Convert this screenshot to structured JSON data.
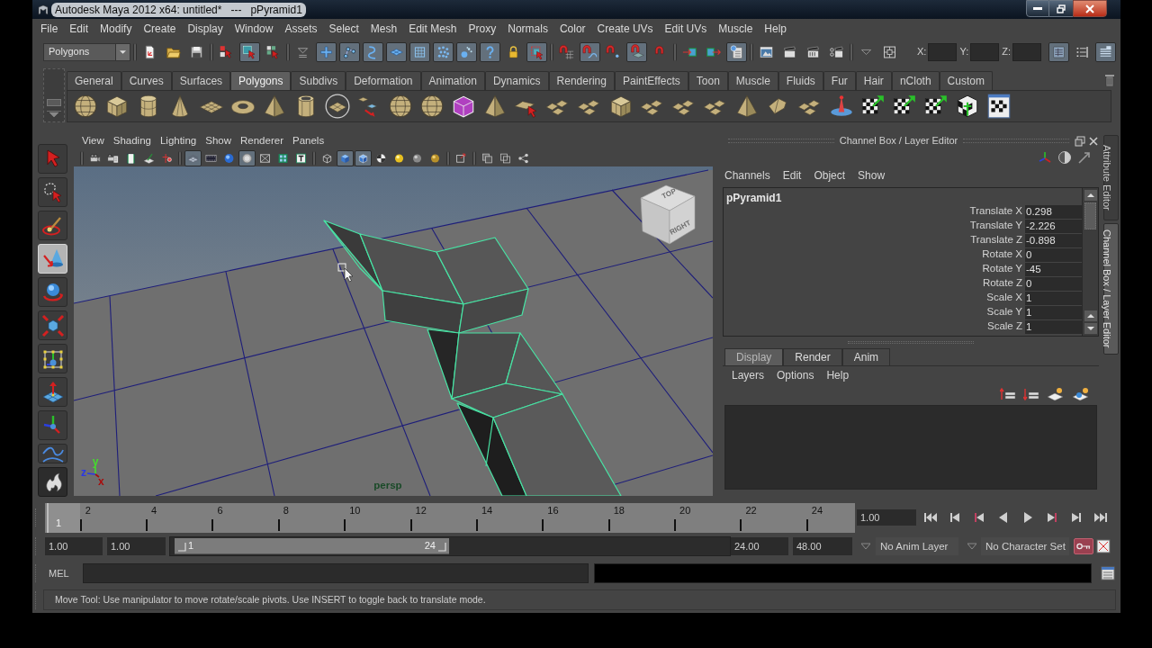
{
  "window": {
    "title": "Autodesk Maya 2012 x64: untitled*   ---   pPyramid1"
  },
  "menu_bar": [
    "File",
    "Edit",
    "Modify",
    "Create",
    "Display",
    "Window",
    "Assets",
    "Select",
    "Mesh",
    "Edit Mesh",
    "Proxy",
    "Normals",
    "Color",
    "Create UVs",
    "Edit UVs",
    "Muscle",
    "Help"
  ],
  "status_line": {
    "menu_set": "Polygons",
    "toggle_groups": [
      [
        {
          "kind": "new-scene",
          "on": false
        },
        {
          "kind": "open-scene",
          "on": false
        },
        {
          "kind": "save-scene",
          "on": false
        }
      ],
      [
        {
          "kind": "select-hierarchy",
          "on": false
        },
        {
          "kind": "select-object",
          "on": true
        },
        {
          "kind": "select-component",
          "on": false
        }
      ],
      [
        {
          "kind": "mask-menu",
          "on": false
        },
        {
          "kind": "mask-handles",
          "on": true
        },
        {
          "kind": "mask-joints",
          "on": true
        },
        {
          "kind": "mask-curves",
          "on": true
        },
        {
          "kind": "mask-surfaces",
          "on": true
        },
        {
          "kind": "mask-deformers",
          "on": true
        },
        {
          "kind": "mask-dynamics",
          "on": true
        },
        {
          "kind": "mask-rendering",
          "on": true
        },
        {
          "kind": "mask-misc",
          "on": true
        },
        {
          "kind": "lock",
          "on": false
        },
        {
          "kind": "highlight",
          "on": true
        }
      ],
      [
        {
          "kind": "snap-grid",
          "on": false
        },
        {
          "kind": "snap-curve",
          "on": true
        },
        {
          "kind": "snap-point",
          "on": false
        },
        {
          "kind": "snap-plane",
          "on": true
        },
        {
          "kind": "make-live",
          "on": false
        }
      ],
      [
        {
          "kind": "inputs",
          "on": false
        },
        {
          "kind": "outputs",
          "on": false
        },
        {
          "kind": "history",
          "on": true
        }
      ],
      [
        {
          "kind": "render-view",
          "on": false
        },
        {
          "kind": "render",
          "on": false
        },
        {
          "kind": "ipr",
          "on": false
        },
        {
          "kind": "render-settings",
          "on": false
        }
      ],
      [
        {
          "kind": "input-menu",
          "on": false
        },
        {
          "kind": "transform-mode",
          "on": false
        }
      ]
    ],
    "fields": [
      {
        "label": "X:"
      },
      {
        "label": "Y:"
      },
      {
        "label": "Z:"
      }
    ],
    "panel_toggles": [
      {
        "kind": "attribute-editor",
        "on": true
      },
      {
        "kind": "tool-settings",
        "on": false
      },
      {
        "kind": "channel-box",
        "on": true
      }
    ]
  },
  "shelf": {
    "tabs": [
      {
        "label": "General",
        "selected": false
      },
      {
        "label": "Curves",
        "selected": false
      },
      {
        "label": "Surfaces",
        "selected": false
      },
      {
        "label": "Polygons",
        "selected": true
      },
      {
        "label": "Subdivs",
        "selected": false
      },
      {
        "label": "Deformation",
        "selected": false
      },
      {
        "label": "Animation",
        "selected": false
      },
      {
        "label": "Dynamics",
        "selected": false
      },
      {
        "label": "Rendering",
        "selected": false
      },
      {
        "label": "PaintEffects",
        "selected": false
      },
      {
        "label": "Toon",
        "selected": false
      },
      {
        "label": "Muscle",
        "selected": false
      },
      {
        "label": "Fluids",
        "selected": false
      },
      {
        "label": "Fur",
        "selected": false
      },
      {
        "label": "Hair",
        "selected": false
      },
      {
        "label": "nCloth",
        "selected": false
      },
      {
        "label": "Custom",
        "selected": false
      }
    ]
  },
  "toolbox": [
    {
      "kind": "select",
      "selected": false
    },
    {
      "kind": "lasso",
      "selected": false
    },
    {
      "kind": "paint",
      "selected": false
    },
    {
      "kind": "move",
      "selected": true
    },
    {
      "kind": "rotate",
      "selected": false
    },
    {
      "kind": "scale",
      "selected": false
    },
    {
      "kind": "universal",
      "selected": false
    },
    {
      "kind": "soft-mod",
      "selected": false
    },
    {
      "kind": "show-manip",
      "selected": false
    },
    {
      "kind": "curve",
      "selected": false
    },
    {
      "kind": "last-tool",
      "selected": false
    }
  ],
  "viewport": {
    "menu": [
      "View",
      "Shading",
      "Lighting",
      "Show",
      "Renderer",
      "Panels"
    ],
    "toolbar_groups": [
      [
        {
          "kind": "camera",
          "on": false
        },
        {
          "kind": "camera-attributes",
          "on": false
        },
        {
          "kind": "bookmarks",
          "on": false
        },
        {
          "kind": "image-plane",
          "on": false
        },
        {
          "kind": "pan-zoom",
          "on": false
        }
      ],
      [
        {
          "kind": "grid",
          "on": true
        },
        {
          "kind": "film-gate",
          "on": false
        },
        {
          "kind": "resolution-gate",
          "on": false
        },
        {
          "kind": "gate-mask",
          "on": true
        },
        {
          "kind": "field-chart",
          "on": false
        },
        {
          "kind": "safe-action",
          "on": false
        },
        {
          "kind": "safe-title",
          "on": false
        }
      ],
      [
        {
          "kind": "wireframe",
          "on": false
        },
        {
          "kind": "smooth-shade",
          "on": true
        },
        {
          "kind": "wire-on-shaded",
          "on": true
        },
        {
          "kind": "textured",
          "on": false
        },
        {
          "kind": "lights",
          "on": false
        },
        {
          "kind": "shadows",
          "on": false
        },
        {
          "kind": "hardware",
          "on": false
        }
      ],
      [
        {
          "kind": "isolate",
          "on": false
        }
      ],
      [
        {
          "kind": "xray",
          "on": false
        },
        {
          "kind": "xray-joints",
          "on": false
        },
        {
          "kind": "share",
          "on": false
        }
      ]
    ],
    "view_cube": {
      "top": "TOP",
      "right": "RIGHT"
    },
    "axis_indicator": [
      {
        "label": "y",
        "color": "#44dd2c"
      },
      {
        "label": "z",
        "color": "#2a38e6"
      },
      {
        "label": "x",
        "color": "#a80c0c"
      }
    ],
    "camera": "persp"
  },
  "channel_box": {
    "title": "Channel Box / Layer Editor",
    "menu": [
      "Channels",
      "Edit",
      "Object",
      "Show"
    ],
    "object": "pPyramid1",
    "channels": [
      {
        "name": "Translate X",
        "value": "0.298"
      },
      {
        "name": "Translate Y",
        "value": "-2.226"
      },
      {
        "name": "Translate Z",
        "value": "-0.898"
      },
      {
        "name": "Rotate X",
        "value": "0"
      },
      {
        "name": "Rotate Y",
        "value": "-45"
      },
      {
        "name": "Rotate Z",
        "value": "0"
      },
      {
        "name": "Scale X",
        "value": "1"
      },
      {
        "name": "Scale Y",
        "value": "1"
      },
      {
        "name": "Scale Z",
        "value": "1"
      }
    ]
  },
  "layer_editor": {
    "tabs": [
      {
        "label": "Display",
        "selected": true
      },
      {
        "label": "Render",
        "selected": false
      },
      {
        "label": "Anim",
        "selected": false
      }
    ],
    "menu": [
      "Layers",
      "Options",
      "Help"
    ]
  },
  "side_tabs": [
    {
      "label": "Attribute Editor",
      "selected": false
    },
    {
      "label": "Channel Box / Layer Editor",
      "selected": true
    }
  ],
  "time_slider": {
    "ticks": [
      "2",
      "4",
      "6",
      "8",
      "10",
      "12",
      "14",
      "16",
      "18",
      "20",
      "22",
      "24"
    ],
    "current_frame": "1",
    "level": 0,
    "current_time": "1.00"
  },
  "range_slider": {
    "animation_start": "1.00",
    "playback_start": "1.00",
    "range_start": "1",
    "range_end": "24",
    "playback_end": "24.00",
    "animation_end": "48.00",
    "anim_layer": "No Anim Layer",
    "character_set": "No Character Set"
  },
  "command_line": {
    "language": "MEL"
  },
  "help_line": "Move Tool: Use manipulator to move rotate/scale pivots. Use INSERT to toggle back to translate mode."
}
